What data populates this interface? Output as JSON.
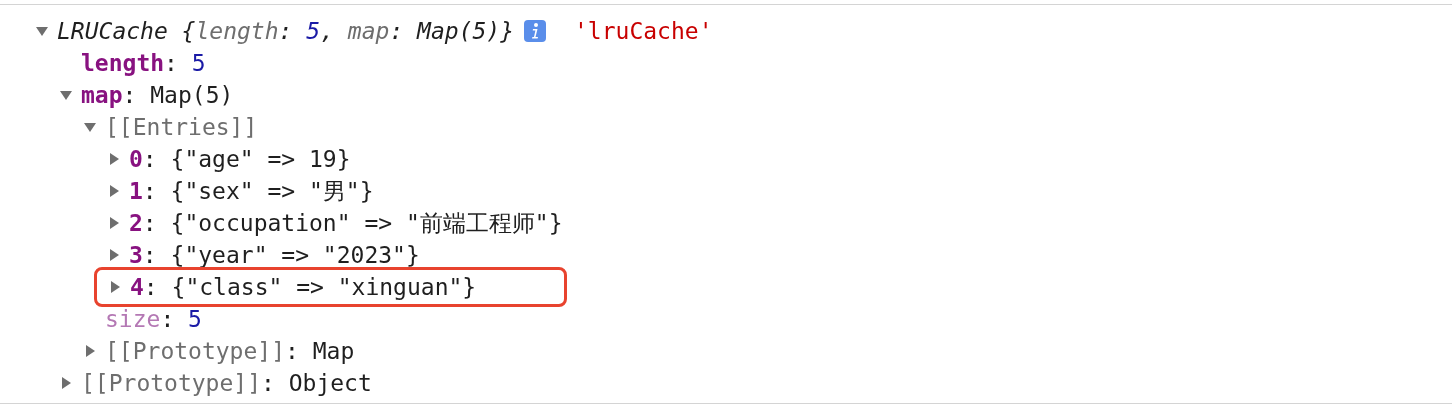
{
  "root": {
    "expanded": true,
    "preview": [
      {
        "text": "LRUCache {",
        "kind": "plain"
      },
      {
        "text": "length",
        "kind": "key"
      },
      {
        "text": ": ",
        "kind": "plain"
      },
      {
        "text": "5",
        "kind": "number"
      },
      {
        "text": ", ",
        "kind": "plain"
      },
      {
        "text": "map",
        "kind": "key"
      },
      {
        "text": ": Map(5)}",
        "kind": "plain"
      }
    ],
    "info": true,
    "label": "'lruCache'",
    "children": [
      {
        "parts": [
          {
            "text": "length",
            "kind": "key"
          },
          {
            "text": ": ",
            "kind": "plain"
          },
          {
            "text": "5",
            "kind": "number"
          }
        ]
      },
      {
        "expanded": true,
        "parts": [
          {
            "text": "map",
            "kind": "key"
          },
          {
            "text": ": Map(5)",
            "kind": "plain"
          }
        ],
        "children": [
          {
            "expanded": true,
            "parts": [
              {
                "text": "[[Entries]]",
                "kind": "internal"
              }
            ],
            "children": [
              {
                "expanded": false,
                "highlighted": false,
                "parts": [
                  {
                    "text": "0",
                    "kind": "key"
                  },
                  {
                    "text": ": {\"age\" => 19}",
                    "kind": "plain"
                  }
                ]
              },
              {
                "expanded": false,
                "highlighted": false,
                "parts": [
                  {
                    "text": "1",
                    "kind": "key"
                  },
                  {
                    "text": ": {\"sex\" => \"男\"}",
                    "kind": "plain"
                  }
                ]
              },
              {
                "expanded": false,
                "highlighted": false,
                "parts": [
                  {
                    "text": "2",
                    "kind": "key"
                  },
                  {
                    "text": ": {\"occupation\" => \"前端工程师\"}",
                    "kind": "plain"
                  }
                ]
              },
              {
                "expanded": false,
                "highlighted": false,
                "parts": [
                  {
                    "text": "3",
                    "kind": "key"
                  },
                  {
                    "text": ": {\"year\" => \"2023\"}",
                    "kind": "plain"
                  }
                ]
              },
              {
                "expanded": false,
                "highlighted": true,
                "parts": [
                  {
                    "text": "4",
                    "kind": "key"
                  },
                  {
                    "text": ": {\"class\" => \"xinguan\"}",
                    "kind": "plain"
                  }
                ]
              }
            ]
          },
          {
            "parts": [
              {
                "text": "size",
                "kind": "synthetic"
              },
              {
                "text": ": ",
                "kind": "plain"
              },
              {
                "text": "5",
                "kind": "number"
              }
            ]
          },
          {
            "expanded": false,
            "parts": [
              {
                "text": "[[Prototype]]",
                "kind": "internal"
              },
              {
                "text": ": Map",
                "kind": "plain"
              }
            ]
          }
        ]
      },
      {
        "expanded": false,
        "parts": [
          {
            "text": "[[Prototype]]",
            "kind": "internal"
          },
          {
            "text": ": Object",
            "kind": "plain"
          }
        ]
      }
    ]
  }
}
